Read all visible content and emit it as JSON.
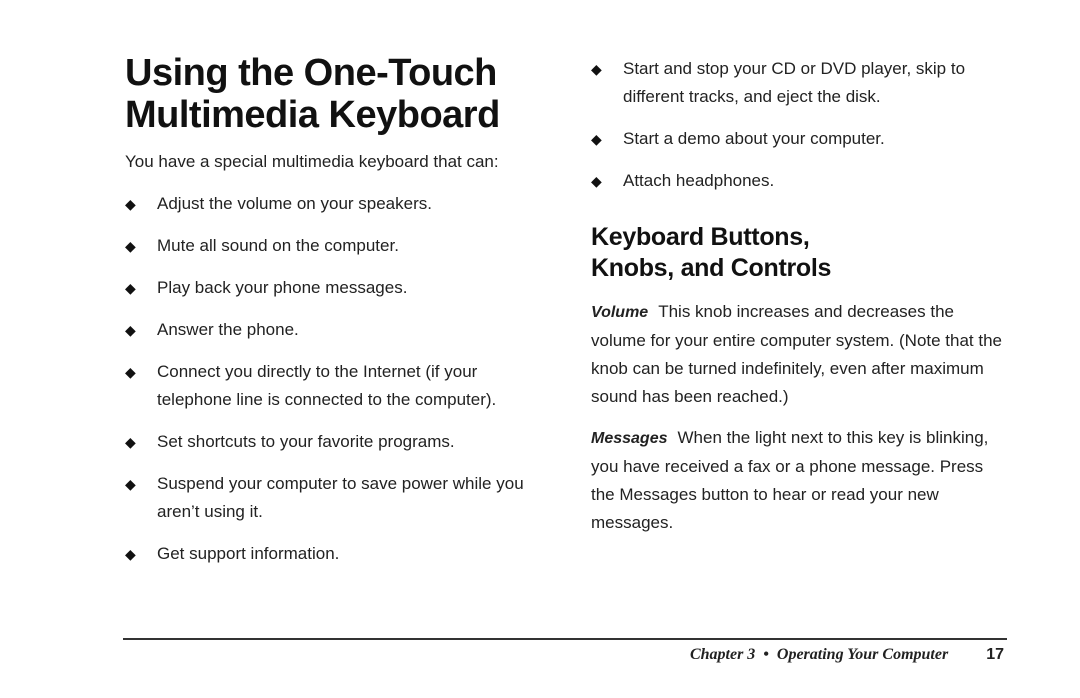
{
  "title": {
    "line1": "Using the One-Touch",
    "line2": "Multimedia Keyboard"
  },
  "intro": "You have a special multimedia keyboard that can:",
  "left_bullets": [
    "Adjust the volume on your speakers.",
    "Mute all sound on the computer.",
    "Play back your phone messages.",
    "Answer the phone.",
    "Connect you directly to the Internet (if your telephone line is connected to the computer).",
    "Set shortcuts to your favorite programs.",
    "Suspend your computer to save power while you aren’t using it.",
    "Get support information."
  ],
  "right_bullets": [
    "Start and stop your CD or DVD player, skip to different tracks, and eject the disk.",
    "Start a demo about your computer.",
    "Attach headphones."
  ],
  "bullet_glyph": "◆",
  "subhead": {
    "line1": "Keyboard Buttons,",
    "line2": "Knobs, and Controls"
  },
  "volume": {
    "term": "Volume",
    "text": "This knob increases and decreases the volume for your entire computer system. (Note that the knob can be turned indefinitely, even after maximum sound has been reached.)"
  },
  "messages": {
    "term": "Messages",
    "text": "When the light next to this key is blinking, you have received a fax or a phone message. Press the Messages button to hear or read your new messages."
  },
  "footer": {
    "chapter": "Chapter 3  •  Operating Your Computer",
    "page": "17"
  }
}
